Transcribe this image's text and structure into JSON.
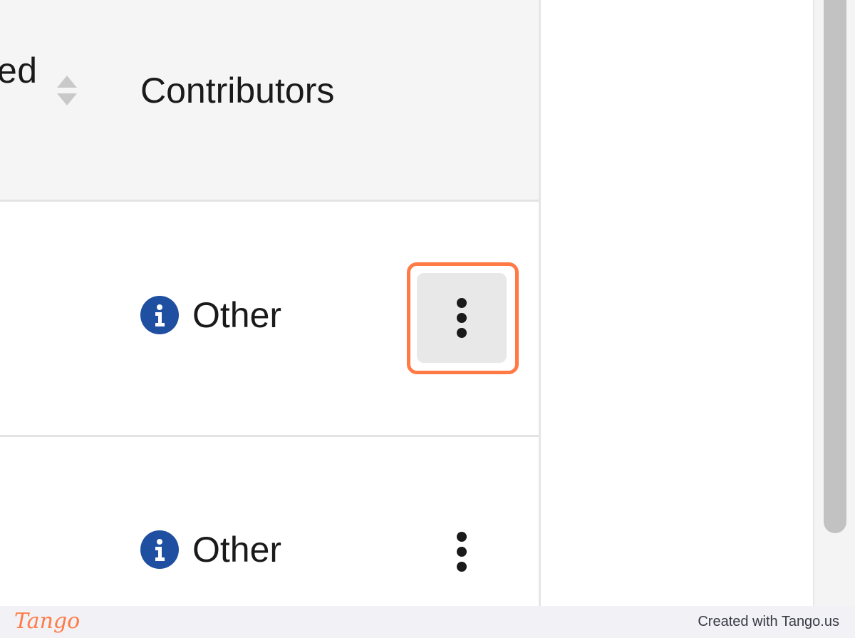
{
  "table": {
    "header": {
      "prev_column_label": "ed",
      "contributors_label": "Contributors"
    },
    "rows": [
      {
        "contributor": "Other",
        "info_icon": "info-icon",
        "menu_icon": "kebab-vertical-icon"
      },
      {
        "contributor": "Other",
        "info_icon": "info-icon",
        "menu_icon": "kebab-vertical-icon"
      }
    ]
  },
  "footer": {
    "logo_text": "Tango",
    "credit_text": "Created with Tango.us"
  },
  "colors": {
    "highlight": "#ff7a45",
    "info_icon": "#1f4fa0",
    "header_bg": "#f5f5f5",
    "menu_button_bg": "#e8e8e8"
  }
}
